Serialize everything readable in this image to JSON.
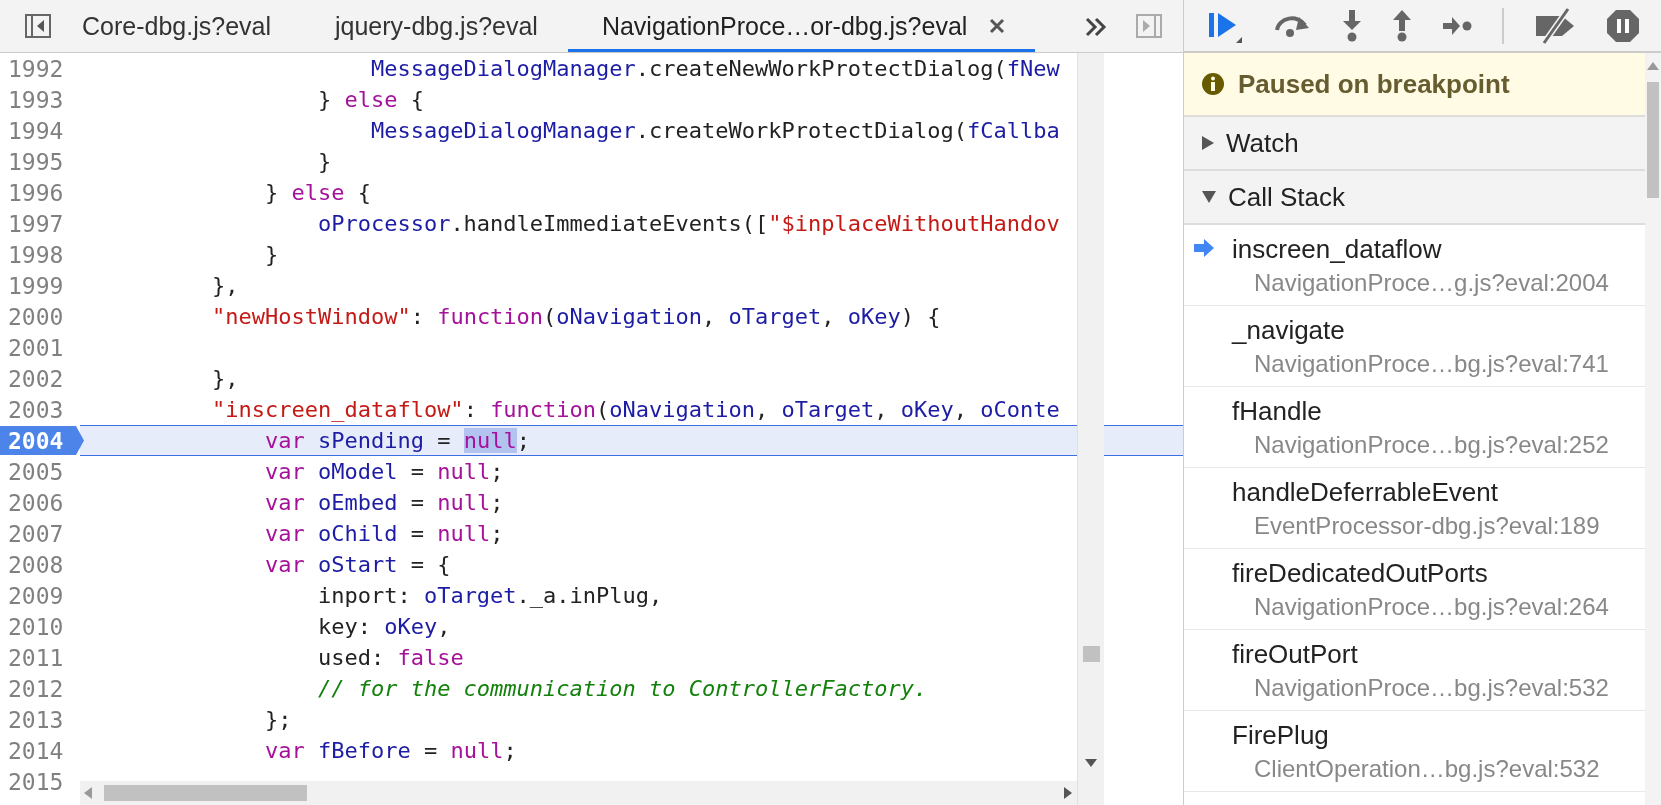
{
  "tabs": [
    {
      "label": "Core-dbg.js?eval",
      "selected": false
    },
    {
      "label": "jquery-dbg.js?eval",
      "selected": false
    },
    {
      "label": "NavigationProce…or-dbg.js?eval",
      "selected": true
    }
  ],
  "code": {
    "lines": [
      {
        "number": "1992",
        "breakpoint": false,
        "paused": false,
        "tokens": [
          {
            "kind": "variable",
            "text": "                    MessageDialogManager"
          },
          {
            "kind": "plain",
            "text": ".createNewWorkProtectDialog("
          },
          {
            "kind": "variable",
            "text": "fNew"
          }
        ]
      },
      {
        "number": "1993",
        "breakpoint": false,
        "paused": false,
        "tokens": [
          {
            "kind": "plain",
            "text": "                } "
          },
          {
            "kind": "keyword",
            "text": "else"
          },
          {
            "kind": "plain",
            "text": " {"
          }
        ]
      },
      {
        "number": "1994",
        "breakpoint": false,
        "paused": false,
        "tokens": [
          {
            "kind": "variable",
            "text": "                    MessageDialogManager"
          },
          {
            "kind": "plain",
            "text": ".createWorkProtectDialog("
          },
          {
            "kind": "variable",
            "text": "fCallba"
          }
        ]
      },
      {
        "number": "1995",
        "breakpoint": false,
        "paused": false,
        "tokens": [
          {
            "kind": "plain",
            "text": "                }"
          }
        ]
      },
      {
        "number": "1996",
        "breakpoint": false,
        "paused": false,
        "tokens": [
          {
            "kind": "plain",
            "text": "            } "
          },
          {
            "kind": "keyword",
            "text": "else"
          },
          {
            "kind": "plain",
            "text": " {"
          }
        ]
      },
      {
        "number": "1997",
        "breakpoint": false,
        "paused": false,
        "tokens": [
          {
            "kind": "variable",
            "text": "                oProcessor"
          },
          {
            "kind": "plain",
            "text": ".handleImmediateEvents(["
          },
          {
            "kind": "string",
            "text": "\"$inplaceWithoutHandov"
          }
        ]
      },
      {
        "number": "1998",
        "breakpoint": false,
        "paused": false,
        "tokens": [
          {
            "kind": "plain",
            "text": "            }"
          }
        ]
      },
      {
        "number": "1999",
        "breakpoint": false,
        "paused": false,
        "tokens": [
          {
            "kind": "plain",
            "text": "        },"
          }
        ]
      },
      {
        "number": "2000",
        "breakpoint": false,
        "paused": false,
        "tokens": [
          {
            "kind": "string",
            "text": "        \"newHostWindow\""
          },
          {
            "kind": "plain",
            "text": ": "
          },
          {
            "kind": "keyword",
            "text": "function"
          },
          {
            "kind": "plain",
            "text": "("
          },
          {
            "kind": "variable",
            "text": "oNavigation"
          },
          {
            "kind": "plain",
            "text": ", "
          },
          {
            "kind": "variable",
            "text": "oTarget"
          },
          {
            "kind": "plain",
            "text": ", "
          },
          {
            "kind": "variable",
            "text": "oKey"
          },
          {
            "kind": "plain",
            "text": ") {"
          }
        ]
      },
      {
        "number": "2001",
        "breakpoint": false,
        "paused": false
      },
      {
        "number": "2002",
        "breakpoint": false,
        "paused": false,
        "tokens": [
          {
            "kind": "plain",
            "text": "        },"
          }
        ]
      },
      {
        "number": "2003",
        "breakpoint": false,
        "paused": false,
        "tokens": [
          {
            "kind": "string",
            "text": "        \"inscreen_dataflow\""
          },
          {
            "kind": "plain",
            "text": ": "
          },
          {
            "kind": "keyword",
            "text": "function"
          },
          {
            "kind": "plain",
            "text": "("
          },
          {
            "kind": "variable",
            "text": "oNavigation"
          },
          {
            "kind": "plain",
            "text": ", "
          },
          {
            "kind": "variable",
            "text": "oTarget"
          },
          {
            "kind": "plain",
            "text": ", "
          },
          {
            "kind": "variable",
            "text": "oKey"
          },
          {
            "kind": "plain",
            "text": ", "
          },
          {
            "kind": "variable",
            "text": "oConte"
          }
        ]
      },
      {
        "number": "2004",
        "breakpoint": true,
        "paused": true,
        "tokens": [
          {
            "kind": "keyword",
            "text": "            var"
          },
          {
            "kind": "variable",
            "text": " sPending"
          },
          {
            "kind": "plain",
            "text": " = "
          },
          {
            "kind": "match",
            "text": "null"
          },
          {
            "kind": "plain",
            "text": ";"
          }
        ]
      },
      {
        "number": "2005",
        "breakpoint": false,
        "paused": false,
        "tokens": [
          {
            "kind": "keyword",
            "text": "            var"
          },
          {
            "kind": "variable",
            "text": " oModel"
          },
          {
            "kind": "plain",
            "text": " = "
          },
          {
            "kind": "keyword",
            "text": "null"
          },
          {
            "kind": "plain",
            "text": ";"
          }
        ]
      },
      {
        "number": "2006",
        "breakpoint": false,
        "paused": false,
        "tokens": [
          {
            "kind": "keyword",
            "text": "            var"
          },
          {
            "kind": "variable",
            "text": " oEmbed"
          },
          {
            "kind": "plain",
            "text": " = "
          },
          {
            "kind": "keyword",
            "text": "null"
          },
          {
            "kind": "plain",
            "text": ";"
          }
        ]
      },
      {
        "number": "2007",
        "breakpoint": false,
        "paused": false,
        "tokens": [
          {
            "kind": "keyword",
            "text": "            var"
          },
          {
            "kind": "variable",
            "text": " oChild"
          },
          {
            "kind": "plain",
            "text": " = "
          },
          {
            "kind": "keyword",
            "text": "null"
          },
          {
            "kind": "plain",
            "text": ";"
          }
        ]
      },
      {
        "number": "2008",
        "breakpoint": false,
        "paused": false,
        "tokens": [
          {
            "kind": "keyword",
            "text": "            var"
          },
          {
            "kind": "variable",
            "text": " oStart"
          },
          {
            "kind": "plain",
            "text": " = {"
          }
        ]
      },
      {
        "number": "2009",
        "breakpoint": false,
        "paused": false,
        "tokens": [
          {
            "kind": "plain",
            "text": "                inport: "
          },
          {
            "kind": "variable",
            "text": "oTarget"
          },
          {
            "kind": "plain",
            "text": "._a.inPlug,"
          }
        ]
      },
      {
        "number": "2010",
        "breakpoint": false,
        "paused": false,
        "tokens": [
          {
            "kind": "plain",
            "text": "                key: "
          },
          {
            "kind": "variable",
            "text": "oKey"
          },
          {
            "kind": "plain",
            "text": ","
          }
        ]
      },
      {
        "number": "2011",
        "breakpoint": false,
        "paused": false,
        "tokens": [
          {
            "kind": "plain",
            "text": "                used: "
          },
          {
            "kind": "keyword",
            "text": "false"
          }
        ]
      },
      {
        "number": "2012",
        "breakpoint": false,
        "paused": false,
        "tokens": [
          {
            "kind": "comment",
            "text": "                // for the communication to ControllerFactory."
          }
        ]
      },
      {
        "number": "2013",
        "breakpoint": false,
        "paused": false,
        "tokens": [
          {
            "kind": "plain",
            "text": "            };"
          }
        ]
      },
      {
        "number": "2014",
        "breakpoint": false,
        "paused": false,
        "tokens": [
          {
            "kind": "keyword",
            "text": "            var"
          },
          {
            "kind": "variable",
            "text": " fBefore"
          },
          {
            "kind": "plain",
            "text": " = "
          },
          {
            "kind": "keyword",
            "text": "null"
          },
          {
            "kind": "plain",
            "text": ";"
          }
        ]
      },
      {
        "number": "2015",
        "breakpoint": false,
        "paused": false
      }
    ]
  },
  "debugger": {
    "status": "Paused on breakpoint",
    "sections": [
      {
        "title": "Watch",
        "expanded": false
      },
      {
        "title": "Call Stack",
        "expanded": true
      }
    ],
    "call_stack": [
      {
        "function": "inscreen_dataflow",
        "location": "NavigationProce…g.js?eval:2004",
        "selected": true
      },
      {
        "function": "_navigate",
        "location": "NavigationProce…bg.js?eval:741",
        "selected": false
      },
      {
        "function": "fHandle",
        "location": "NavigationProce…bg.js?eval:252",
        "selected": false
      },
      {
        "function": "handleDeferrableEvent",
        "location": "EventProcessor-dbg.js?eval:189",
        "selected": false
      },
      {
        "function": "fireDedicatedOutPorts",
        "location": "NavigationProce…bg.js?eval:264",
        "selected": false
      },
      {
        "function": "fireOutPort",
        "location": "NavigationProce…bg.js?eval:532",
        "selected": false
      },
      {
        "function": "FirePlug",
        "location": "ClientOperation…bg.js?eval:532",
        "selected": false
      }
    ]
  }
}
